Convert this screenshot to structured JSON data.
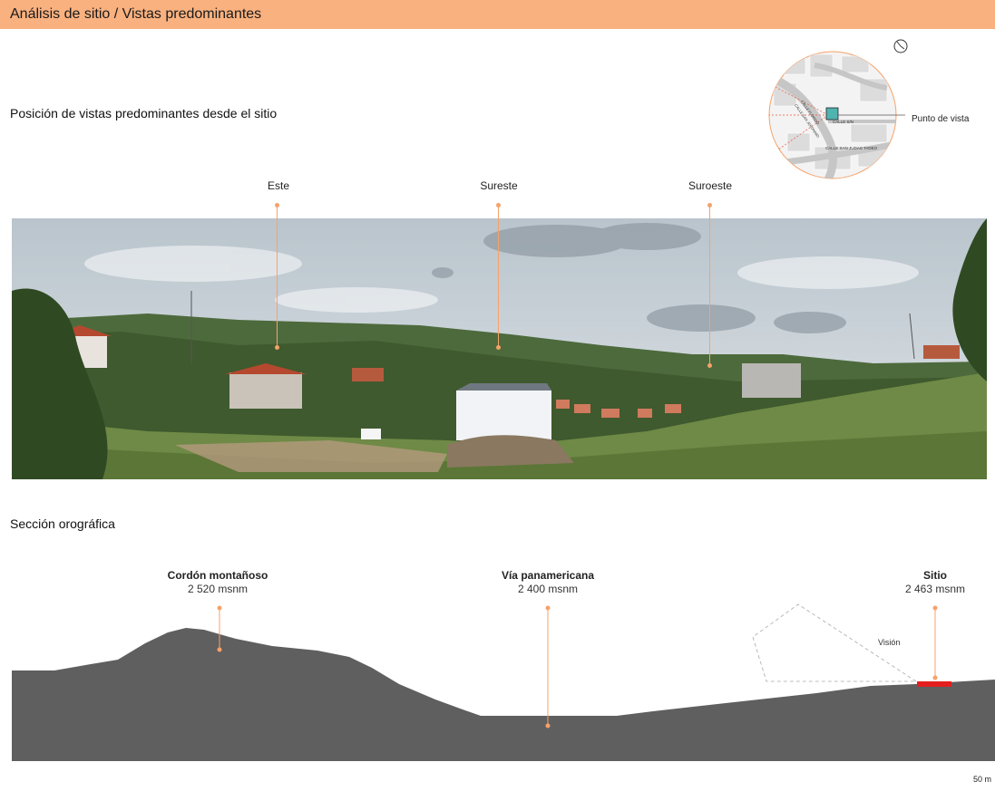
{
  "header": {
    "title": "Análisis de sitio / Vistas predominantes"
  },
  "views": {
    "title": "Posición de vistas predominantes desde el sitio",
    "labels": [
      "Este",
      "Sureste",
      "Suroeste"
    ],
    "map": {
      "label": "Punto de vista",
      "streets": [
        "CALLE S/N",
        "CALLE SAN JUDAS TADEO",
        "CALLE FLORIDO",
        "CALLE SAN JERONIMO"
      ]
    },
    "compass_icon": "compass-icon"
  },
  "section": {
    "title": "Sección orográfica",
    "points": [
      {
        "name": "Cordón montañoso",
        "elevation": "2 520 msnm"
      },
      {
        "name": "Vía panamericana",
        "elevation": "2 400 msnm"
      },
      {
        "name": "Sitio",
        "elevation": "2 463 msnm"
      }
    ],
    "vision_label": "Visión",
    "scale_label": "50 m"
  },
  "colors": {
    "header": "#f9b17f",
    "marker": "#f6a26a",
    "terrain": "#5f5f5f",
    "site": "#e41e1e"
  }
}
